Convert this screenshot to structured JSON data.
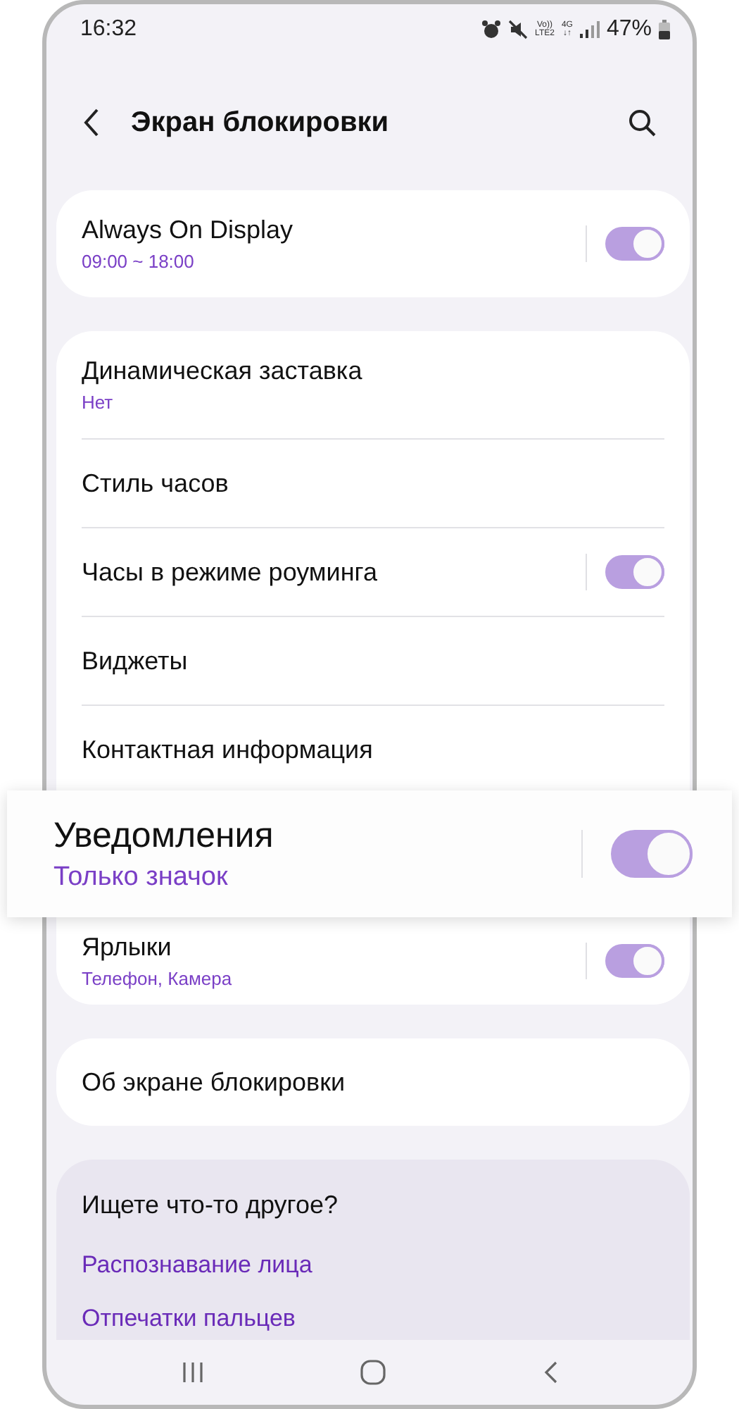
{
  "status_bar": {
    "time": "16:32",
    "indicators": [
      {
        "top": "Vo))",
        "bottom": "LTE2"
      },
      {
        "top": "4G",
        "bottom": "↓↑"
      }
    ],
    "battery": "47%"
  },
  "header": {
    "title": "Экран блокировки"
  },
  "cards": [
    {
      "items": [
        {
          "kind": "toggle",
          "title": "Always On Display",
          "subtitle": "09:00 ~ 18:00",
          "on": true,
          "highlighted": false
        }
      ]
    },
    {
      "items": [
        {
          "kind": "plain",
          "title": "Динамическая заставка",
          "subtitle": "Нет",
          "highlighted": false
        },
        {
          "kind": "plain",
          "title": "Стиль часов",
          "highlighted": false
        },
        {
          "kind": "toggle",
          "title": "Часы в режиме роуминга",
          "on": true,
          "highlighted": false
        },
        {
          "kind": "plain",
          "title": "Виджеты",
          "highlighted": false
        },
        {
          "kind": "plain",
          "title": "Контактная информация",
          "highlighted": false
        },
        {
          "kind": "toggle",
          "title": "Уведомления",
          "subtitle": "Только значок",
          "on": true,
          "highlighted": true
        },
        {
          "kind": "toggle",
          "title": "Ярлыки",
          "subtitle": "Телефон, Камера",
          "on": true,
          "highlighted": false
        }
      ]
    },
    {
      "items": [
        {
          "kind": "plain",
          "title": "Об экране блокировки",
          "highlighted": false
        }
      ]
    }
  ],
  "suggestions": {
    "title": "Ищете что-то другое?",
    "links": [
      "Распознавание лица",
      "Отпечатки пальцев"
    ]
  }
}
